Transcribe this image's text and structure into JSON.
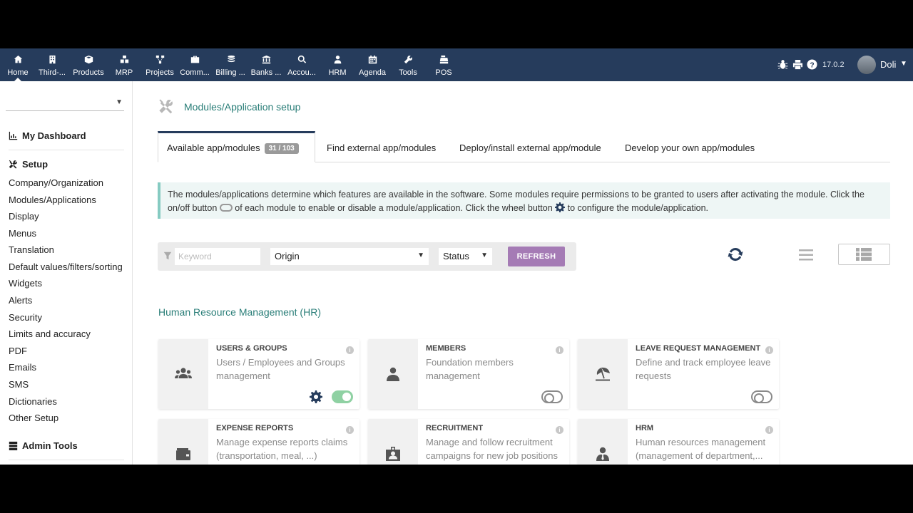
{
  "colors": {
    "topbar": "#263c5c",
    "accent_teal": "#2a7e78",
    "refresh_button": "#a57bb5",
    "toggle_on": "#8fd1a3",
    "info_bg": "#eef6f5"
  },
  "topnav": {
    "items": [
      {
        "label": "Home",
        "icon": "home-icon",
        "active": true
      },
      {
        "label": "Third-...",
        "icon": "building-icon"
      },
      {
        "label": "Products",
        "icon": "cube-icon"
      },
      {
        "label": "MRP",
        "icon": "cubes-icon"
      },
      {
        "label": "Projects",
        "icon": "sitemap-icon"
      },
      {
        "label": "Comm...",
        "icon": "suitcase-icon"
      },
      {
        "label": "Billing ...",
        "icon": "coins-icon"
      },
      {
        "label": "Banks ...",
        "icon": "bank-icon"
      },
      {
        "label": "Accou...",
        "icon": "search-dollar-icon"
      },
      {
        "label": "HRM",
        "icon": "user-tie-icon"
      },
      {
        "label": "Agenda",
        "icon": "calendar-icon"
      },
      {
        "label": "Tools",
        "icon": "wrench-icon"
      },
      {
        "label": "POS",
        "icon": "cash-register-icon"
      }
    ],
    "version": "17.0.2",
    "user": "Doli"
  },
  "sidebar": {
    "dashboard": "My Dashboard",
    "setup": "Setup",
    "links": [
      "Company/Organization",
      "Modules/Applications",
      "Display",
      "Menus",
      "Translation",
      "Default values/filters/sorting",
      "Widgets",
      "Alerts",
      "Security",
      "Limits and accuracy",
      "PDF",
      "Emails",
      "SMS",
      "Dictionaries",
      "Other Setup"
    ],
    "admin_tools": "Admin Tools"
  },
  "page": {
    "title": "Modules/Application setup",
    "tabs": [
      {
        "label": "Available app/modules",
        "badge": "31 / 103"
      },
      {
        "label": "Find external app/modules"
      },
      {
        "label": "Deploy/install external app/module"
      },
      {
        "label": "Develop your own app/modules"
      }
    ],
    "info": {
      "part1": "The modules/applications determine which features are available in the software. Some modules require permissions to be granted to users after activating the module. Click the on/off button",
      "part2": "of each module to enable or disable a module/application. Click the wheel button",
      "part3": "to configure the module/application."
    },
    "filters": {
      "keyword_placeholder": "Keyword",
      "origin": "Origin",
      "status": "Status",
      "refresh": "REFRESH"
    },
    "section_title": "Human Resource Management (HR)",
    "modules": [
      {
        "title": "USERS & GROUPS",
        "desc": "Users / Employees and Groups management",
        "icon": "users-icon",
        "enabled": true
      },
      {
        "title": "MEMBERS",
        "desc": "Foundation members management",
        "icon": "user-icon",
        "enabled": false
      },
      {
        "title": "LEAVE REQUEST MANAGEMENT",
        "desc": "Define and track employee leave requests",
        "icon": "umbrella-beach-icon",
        "enabled": false
      },
      {
        "title": "EXPENSE REPORTS",
        "desc": "Manage expense reports claims (transportation, meal, ...)",
        "icon": "wallet-icon",
        "enabled": false
      },
      {
        "title": "RECRUITMENT",
        "desc": "Manage and follow recruitment campaigns for new job positions",
        "icon": "id-badge-icon",
        "enabled": false
      },
      {
        "title": "HRM",
        "desc": "Human resources management (management of department,...",
        "icon": "user-tie-icon",
        "enabled": false
      }
    ]
  }
}
